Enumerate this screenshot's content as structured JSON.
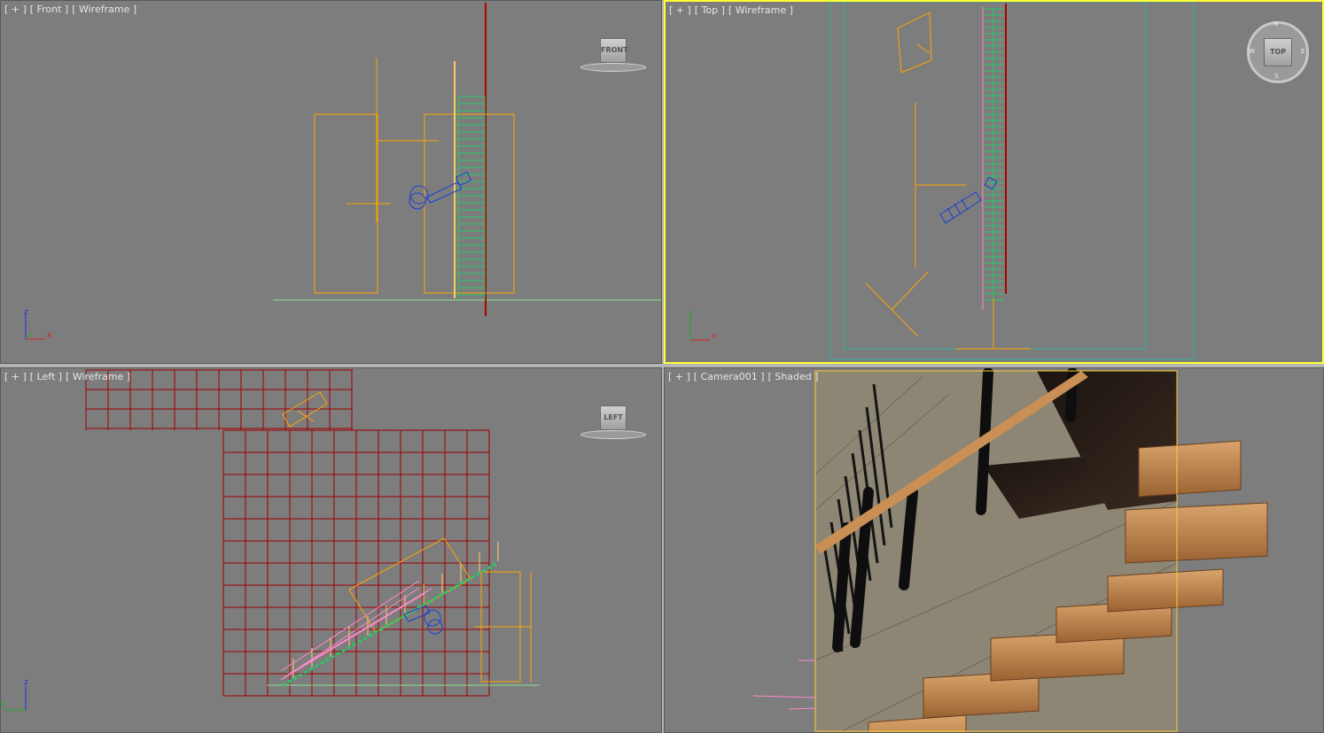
{
  "viewports": {
    "front": {
      "plus": "[ + ]",
      "view": "[ Front ]",
      "mode": "[ Wireframe ]",
      "cube": "FRONT"
    },
    "top": {
      "plus": "[ + ]",
      "view": "[ Top ]",
      "mode": "[ Wireframe ]",
      "cube": "TOP",
      "compass": {
        "n": "N",
        "s": "S",
        "w": "W",
        "e": "E"
      }
    },
    "left": {
      "plus": "[ + ]",
      "view": "[ Left ]",
      "mode": "[ Wireframe ]",
      "cube": "LEFT"
    },
    "camera": {
      "plus": "[ + ]",
      "view": "[ Camera001 ]",
      "mode": "[ Shaded ]"
    }
  },
  "axes": {
    "front": {
      "v": "z",
      "h": "x"
    },
    "top": {
      "v": "y",
      "h": "x"
    },
    "left": {
      "v": "z",
      "h": "y"
    }
  },
  "colors": {
    "viewport_bg": "#7d7d7d",
    "active_border": "#ffff33",
    "selection": "#ffa500",
    "stairs": "#22cc66",
    "railing": "#b00000",
    "camera": "#1a3fd6",
    "pink_rail": "#ff88cc"
  }
}
